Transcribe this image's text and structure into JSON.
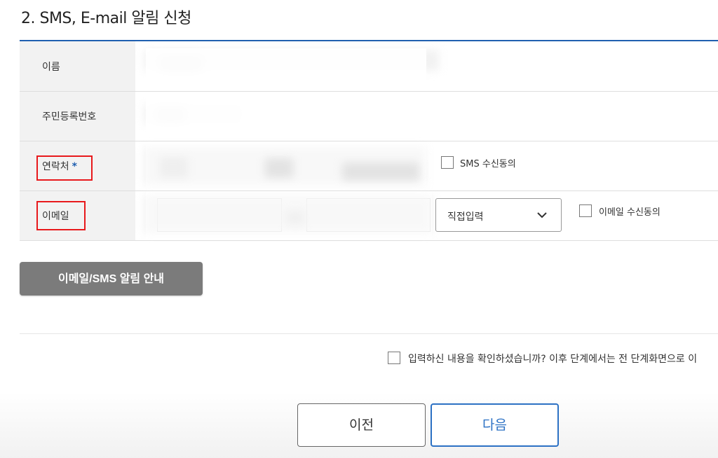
{
  "section": {
    "title": "2. SMS, E-mail 알림 신청"
  },
  "form": {
    "rows": [
      {
        "label": "이름"
      },
      {
        "label": "주민등록번호"
      },
      {
        "label": "연락처",
        "required_mark": "*",
        "checkbox_label": "SMS 수신동의",
        "checked": false
      },
      {
        "label": "이메일",
        "domain_select": "직접입력",
        "checkbox_label": "이메일 수신동의",
        "checked": false
      }
    ]
  },
  "guide_button": {
    "label": "이메일/SMS 알림 안내"
  },
  "confirm": {
    "text": "입력하신 내용을 확인하셨습니까? 이후 단계에서는 전 단계화면으로 이",
    "checked": false
  },
  "nav": {
    "prev_label": "이전",
    "next_label": "다음"
  },
  "colors": {
    "accent": "#1f5fb0",
    "highlight": "#e8191c",
    "next_button": "#2c71c4",
    "guide_button": "#7b7b7b"
  }
}
